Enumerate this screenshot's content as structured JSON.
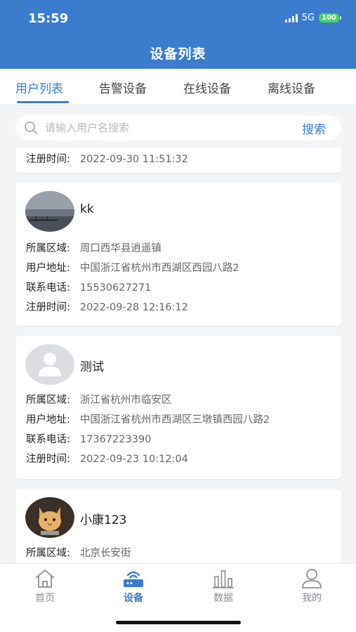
{
  "status_bar": {
    "time": "15:59",
    "network": "5G",
    "battery": "100"
  },
  "header": {
    "title": "设备列表"
  },
  "tabs": [
    {
      "label": "用户列表",
      "active": true
    },
    {
      "label": "告警设备",
      "active": false
    },
    {
      "label": "在线设备",
      "active": false
    },
    {
      "label": "离线设备",
      "active": false
    }
  ],
  "search": {
    "placeholder": "请输入用户名搜索",
    "value": "",
    "button_label": "搜索",
    "icon": "search-icon"
  },
  "partial_card": {
    "register_label": "注册时间:",
    "register_time": "2022-09-30 11:51:32"
  },
  "users": [
    {
      "name": "kk",
      "avatar": "landscape-photo-avatar",
      "region_label": "所属区域:",
      "region": "周口西华县逍遥镇",
      "address_label": "用户地址:",
      "address": "中国浙江省杭州市西湖区西园八路2",
      "phone_label": "联系电话:",
      "phone": "15530627271",
      "register_label": "注册时间:",
      "register_time": "2022-09-28 12:16:12"
    },
    {
      "name": "测试",
      "avatar": "default-user-avatar",
      "region_label": "所属区域:",
      "region": "浙江省杭州市临安区",
      "address_label": "用户地址:",
      "address": "中国浙江省杭州市西湖区三墩镇西园八路2",
      "phone_label": "联系电话:",
      "phone": "17367223390",
      "register_label": "注册时间:",
      "register_time": "2022-09-23 10:12:04"
    },
    {
      "name": "小康123",
      "avatar": "cat-photo-avatar",
      "region_label": "所属区域:",
      "region": "北京长安街"
    }
  ],
  "tabbar": [
    {
      "label": "首页",
      "icon": "home-icon",
      "active": false
    },
    {
      "label": "设备",
      "icon": "router-icon",
      "active": true
    },
    {
      "label": "数据",
      "icon": "bar-chart-icon",
      "active": false
    },
    {
      "label": "我的",
      "icon": "user-icon",
      "active": false
    }
  ],
  "colors": {
    "primary": "#3c7ccc",
    "background": "#f3f4f6",
    "battery": "#49d26a"
  }
}
